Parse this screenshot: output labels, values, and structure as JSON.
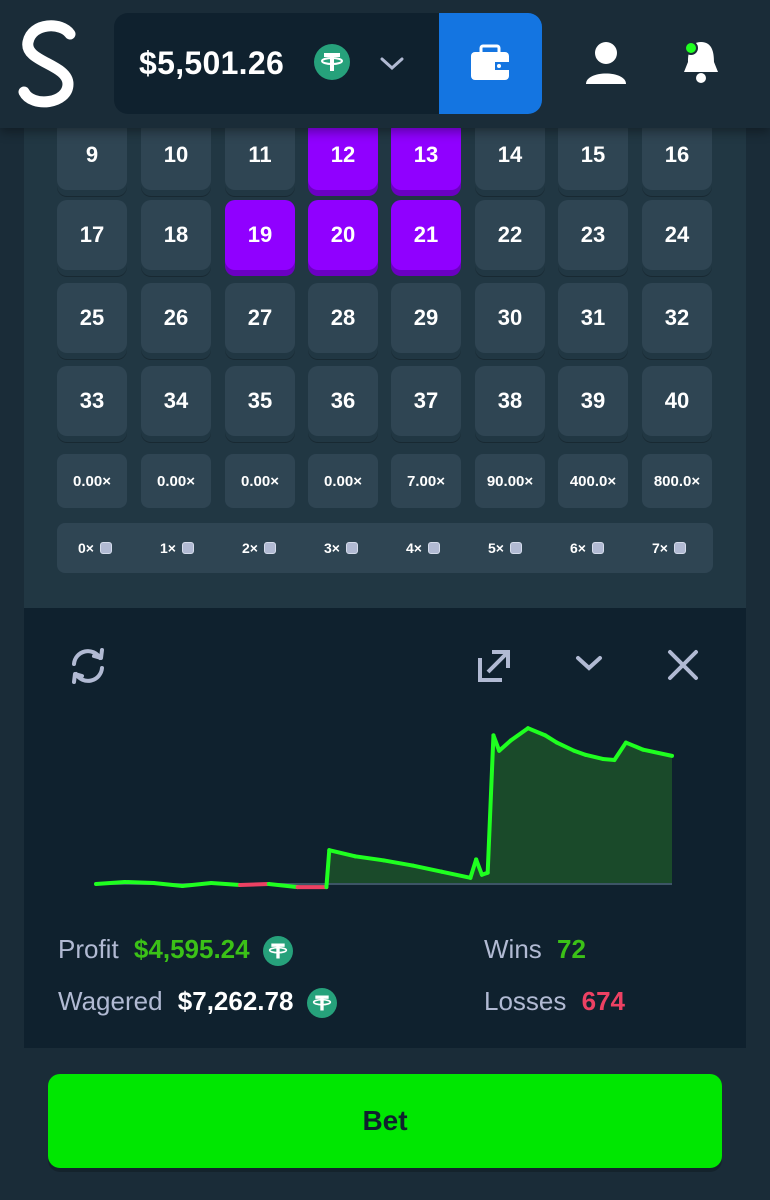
{
  "header": {
    "balance": "$5,501.26",
    "currency_icon": "tether-icon",
    "wallet_icon": "wallet-icon",
    "colors": {
      "wallet": "#1475e1",
      "notification_dot": "#1fff20"
    }
  },
  "grid": {
    "tiles": [
      {
        "n": "9",
        "sel": false
      },
      {
        "n": "10",
        "sel": false
      },
      {
        "n": "11",
        "sel": false
      },
      {
        "n": "12",
        "sel": true
      },
      {
        "n": "13",
        "sel": true
      },
      {
        "n": "14",
        "sel": false
      },
      {
        "n": "15",
        "sel": false
      },
      {
        "n": "16",
        "sel": false
      },
      {
        "n": "17",
        "sel": false
      },
      {
        "n": "18",
        "sel": false
      },
      {
        "n": "19",
        "sel": true
      },
      {
        "n": "20",
        "sel": true
      },
      {
        "n": "21",
        "sel": true
      },
      {
        "n": "22",
        "sel": false
      },
      {
        "n": "23",
        "sel": false
      },
      {
        "n": "24",
        "sel": false
      },
      {
        "n": "25",
        "sel": false
      },
      {
        "n": "26",
        "sel": false
      },
      {
        "n": "27",
        "sel": false
      },
      {
        "n": "28",
        "sel": false
      },
      {
        "n": "29",
        "sel": false
      },
      {
        "n": "30",
        "sel": false
      },
      {
        "n": "31",
        "sel": false
      },
      {
        "n": "32",
        "sel": false
      },
      {
        "n": "33",
        "sel": false
      },
      {
        "n": "34",
        "sel": false
      },
      {
        "n": "35",
        "sel": false
      },
      {
        "n": "36",
        "sel": false
      },
      {
        "n": "37",
        "sel": false
      },
      {
        "n": "38",
        "sel": false
      },
      {
        "n": "39",
        "sel": false
      },
      {
        "n": "40",
        "sel": false
      }
    ],
    "multipliers": [
      "0.00×",
      "0.00×",
      "0.00×",
      "0.00×",
      "7.00×",
      "90.00×",
      "400.0×",
      "800.0×"
    ],
    "hits": [
      "0×",
      "1×",
      "2×",
      "3×",
      "4×",
      "5×",
      "6×",
      "7×"
    ],
    "selected_color": "#9000ff"
  },
  "stats": {
    "profit_label": "Profit",
    "profit_value": "$4,595.24",
    "wagered_label": "Wagered",
    "wagered_value": "$7,262.78",
    "wins_label": "Wins",
    "wins_value": "72",
    "losses_label": "Losses",
    "losses_value": "674"
  },
  "chart_data": {
    "type": "area",
    "x": [
      0,
      5,
      10,
      15,
      20,
      25,
      30,
      35,
      40,
      40.5,
      45,
      50,
      55,
      60,
      65,
      66,
      67,
      68,
      69,
      70,
      72,
      75,
      78,
      80,
      83,
      85,
      88,
      90,
      92,
      95,
      100
    ],
    "values": [
      0,
      2,
      1,
      -2,
      1,
      -1,
      0,
      -3,
      -3,
      33,
      27,
      23,
      18,
      12,
      6,
      24,
      9,
      11,
      145,
      130,
      140,
      152,
      145,
      138,
      130,
      126,
      122,
      121,
      138,
      131,
      125
    ],
    "series": [
      {
        "values": [
          0,
          2,
          1,
          -2,
          1,
          -1,
          0,
          -3,
          -3,
          33,
          27,
          23,
          18,
          12,
          6,
          24,
          9,
          11,
          145,
          130,
          140,
          152,
          145,
          138,
          130,
          126,
          122,
          121,
          138,
          131,
          125
        ]
      }
    ],
    "colors": {
      "positive": "#1fff20",
      "negative": "#ed4163",
      "fill": "#1a4a2a"
    }
  },
  "actions": {
    "bet_label": "Bet"
  }
}
